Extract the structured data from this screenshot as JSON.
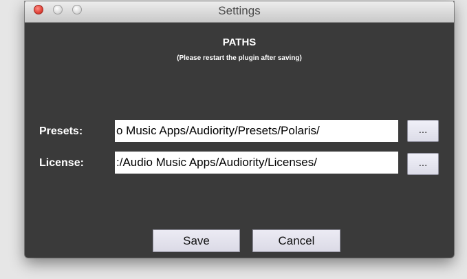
{
  "window": {
    "title": "Settings",
    "controls": [
      "close",
      "minimize",
      "zoom"
    ]
  },
  "header": {
    "title": "PATHS",
    "subtitle": "(Please restart the plugin after saving)"
  },
  "fields": {
    "presets": {
      "label": "Presets:",
      "value": "o Music Apps/Audiority/Presets/Polaris/",
      "browse_label": "..."
    },
    "license": {
      "label": "License:",
      "value": ":/Audio Music Apps/Audiority/Licenses/",
      "browse_label": "..."
    }
  },
  "buttons": {
    "save": "Save",
    "cancel": "Cancel"
  },
  "colors": {
    "window_bg": "#3a3a3a",
    "text": "#ffffff",
    "close": "#e0443a"
  }
}
